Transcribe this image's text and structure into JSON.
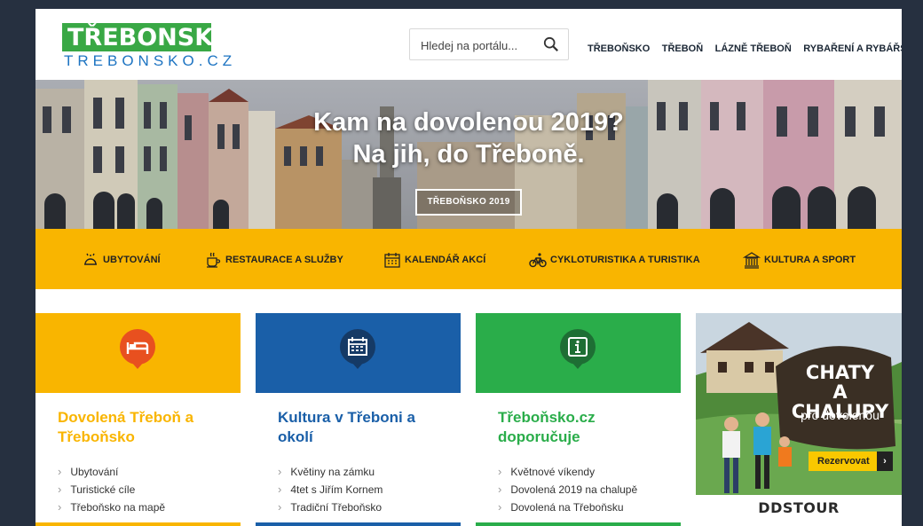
{
  "header": {
    "logo_main": "TŘEBONSKO",
    "logo_sub": "TREBONSKO.CZ",
    "search_placeholder": "Hledej na portálu...",
    "nav": [
      "TŘEBOŇSKO",
      "TŘEBOŇ",
      "LÁZNĚ TŘEBOŇ",
      "RYBAŘENÍ A RYBÁŘSTVÍ"
    ]
  },
  "hero": {
    "title_line1": "Kam na dovolenou 2019?",
    "title_line2": "Na jih, do Třeboně.",
    "button_label": "TŘEBOŇSKO 2019"
  },
  "categories": [
    {
      "label": "UBYTOVÁNÍ",
      "icon": "bell-icon"
    },
    {
      "label": "RESTAURACE A SLUŽBY",
      "icon": "cup-icon"
    },
    {
      "label": "KALENDÁŘ AKCÍ",
      "icon": "calendar-icon"
    },
    {
      "label": "CYKLOTURISTIKA A TURISTIKA",
      "icon": "bicycle-icon"
    },
    {
      "label": "KULTURA A SPORT",
      "icon": "museum-icon"
    }
  ],
  "cards": [
    {
      "title": "Dovolená Třeboň a Třeboňsko",
      "items": [
        "Ubytování",
        "Turistické cíle",
        "Třeboňsko na mapě"
      ],
      "color": "#f9b500",
      "title_color": "#f9b500",
      "badge_color": "#e8501f",
      "icon": "bed-icon"
    },
    {
      "title": "Kultura v Třeboni a okolí",
      "items": [
        "Květiny na zámku",
        "4tet s Jiřím Kornem",
        "Tradiční Třeboňsko"
      ],
      "color": "#1a5fa8",
      "title_color": "#1a5fa8",
      "badge_color": "#153a66",
      "icon": "calendar-icon"
    },
    {
      "title": "Třeboňsko.cz doporučuje",
      "items": [
        "Květnové víkendy",
        "Dovolená 2019 na chalupě",
        "Dovolená na Třeboňsku"
      ],
      "color": "#2aad4a",
      "title_color": "#2aad4a",
      "badge_color": "#1e6e34",
      "icon": "info-icon"
    }
  ],
  "ad": {
    "line1": "CHATY",
    "line2": "A CHALUPY",
    "line3": "pro dovolenou",
    "button": "Rezervovat",
    "brand": "DDSTOUR"
  }
}
